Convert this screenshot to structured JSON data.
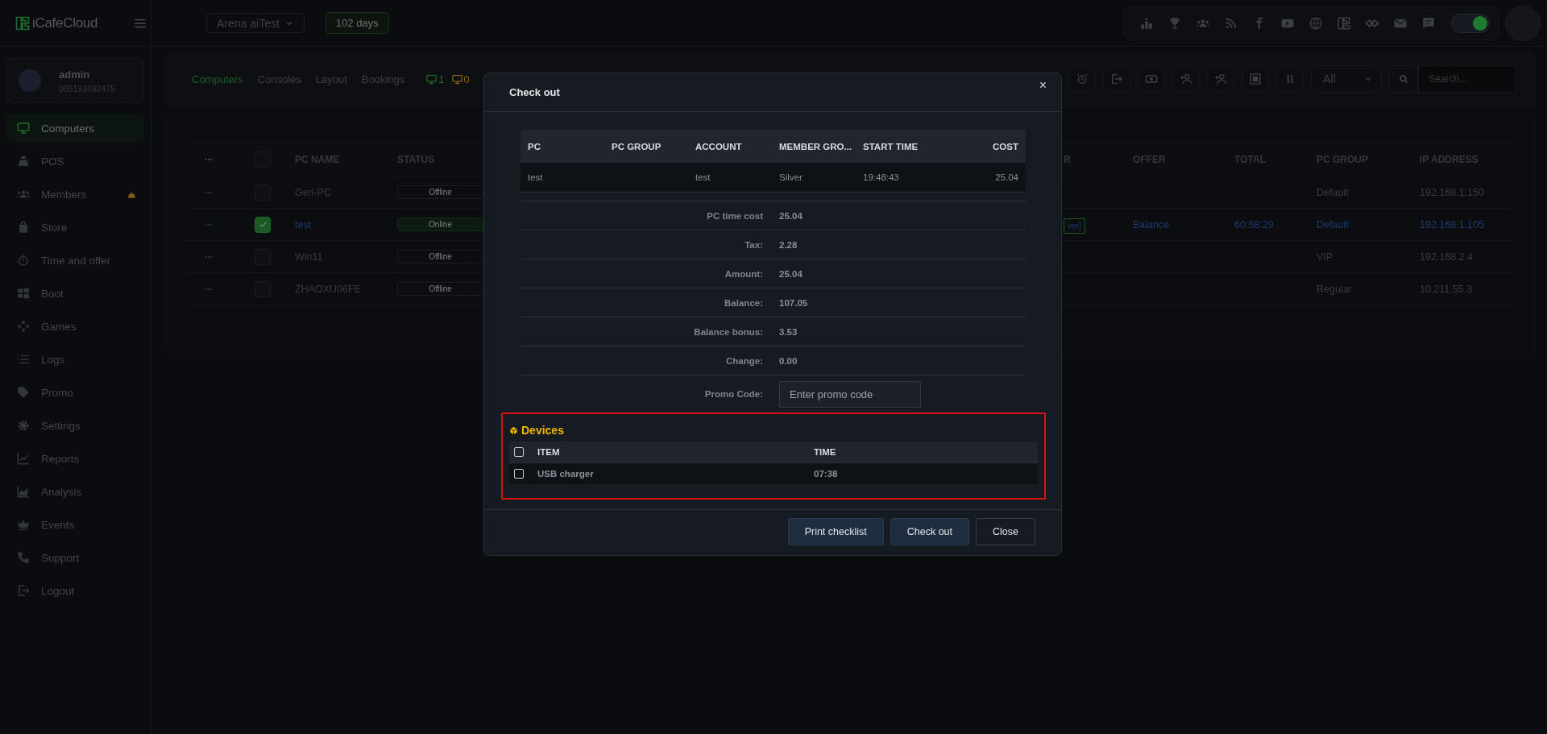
{
  "topbar": {
    "logo": "iCafeCloud",
    "cafe": "Arena aiTest",
    "license": "102 days",
    "status_toggle": {
      "on": true
    }
  },
  "user": {
    "name": "admin",
    "id": "005193482475"
  },
  "sidebar": {
    "items": [
      {
        "label": "Computers",
        "selected": true
      },
      {
        "label": "POS",
        "selected": false
      },
      {
        "label": "Members",
        "selected": false
      },
      {
        "label": "Store",
        "selected": false
      },
      {
        "label": "Time and offer",
        "selected": false
      },
      {
        "label": "Boot",
        "selected": false
      },
      {
        "label": "Games",
        "selected": false
      },
      {
        "label": "Logs",
        "selected": false
      },
      {
        "label": "Promo",
        "selected": false
      },
      {
        "label": "Settings",
        "selected": false
      },
      {
        "label": "Reports",
        "selected": false
      },
      {
        "label": "Analysis",
        "selected": false
      },
      {
        "label": "Events",
        "selected": false
      },
      {
        "label": "Support",
        "selected": false
      },
      {
        "label": "Logout",
        "selected": false
      }
    ]
  },
  "tabs": [
    {
      "label": "Computers",
      "selected": true
    },
    {
      "label": "Consoles",
      "selected": false
    },
    {
      "label": "Layout",
      "selected": false
    },
    {
      "label": "Bookings",
      "selected": false
    }
  ],
  "counters": [
    {
      "value": "1",
      "color": "#1f6a2a"
    },
    {
      "value": "0",
      "color": "#8a6410"
    }
  ],
  "filter": {
    "value": "All"
  },
  "search": {
    "placeholder": "Search..."
  },
  "table": {
    "select_all": {
      "checked": false
    },
    "columns": [
      "PC NAME",
      "STATUS",
      "R",
      "OFFER",
      "TOTAL",
      "PC GROUP",
      "IP ADDRESS"
    ],
    "rows": [
      {
        "selected": false,
        "name": "Geri-PC",
        "status": "Offline",
        "online": false,
        "column_3": "",
        "offer": "",
        "total": "",
        "pc_group": "Default",
        "ip": "192.168.1.150"
      },
      {
        "selected": true,
        "name": "test",
        "status": "Online",
        "online": true,
        "column_3": "ver]",
        "offer": "Balance",
        "total": "60:58:29",
        "pc_group": "Default",
        "ip": "192.168.1.105"
      },
      {
        "selected": false,
        "name": "Win11",
        "status": "Offline",
        "online": false,
        "column_3": "",
        "offer": "",
        "total": "",
        "pc_group": "VIP",
        "ip": "192.168.2.4"
      },
      {
        "selected": false,
        "name": "ZHAOXU06FE",
        "status": "Offline",
        "online": false,
        "column_3": "",
        "offer": "",
        "total": "",
        "pc_group": "Regular",
        "ip": "10.211.55.3"
      }
    ]
  },
  "dialog": {
    "title": "Check out",
    "close": "×",
    "columns": [
      "PC",
      "PC GROUP",
      "ACCOUNT",
      "MEMBER GRO...",
      "START TIME",
      "COST"
    ],
    "rows": [
      [
        "test",
        "",
        "test",
        "Silver",
        "19:48:43",
        "25.04"
      ]
    ],
    "summary": [
      {
        "label": "PC time cost",
        "value": "25.04"
      },
      {
        "label": "Tax:",
        "value": "2.28"
      },
      {
        "label": "Amount:",
        "value": "25.04"
      },
      {
        "label": "Balance:",
        "value": "107.05"
      },
      {
        "label": "Balance bonus:",
        "value": "3.53"
      },
      {
        "label": "Change:",
        "value": "0.00"
      }
    ],
    "promo": {
      "label": "Promo Code:",
      "placeholder": "Enter promo code"
    },
    "devices": {
      "title": "Devices",
      "select_all": {
        "checked": false
      },
      "columns": [
        "ITEM",
        "TIME"
      ],
      "rows": [
        {
          "checked": false,
          "item": "USB charger",
          "time": "07:38"
        }
      ]
    },
    "buttons": [
      "Print checklist",
      "Check out",
      "Close"
    ]
  }
}
